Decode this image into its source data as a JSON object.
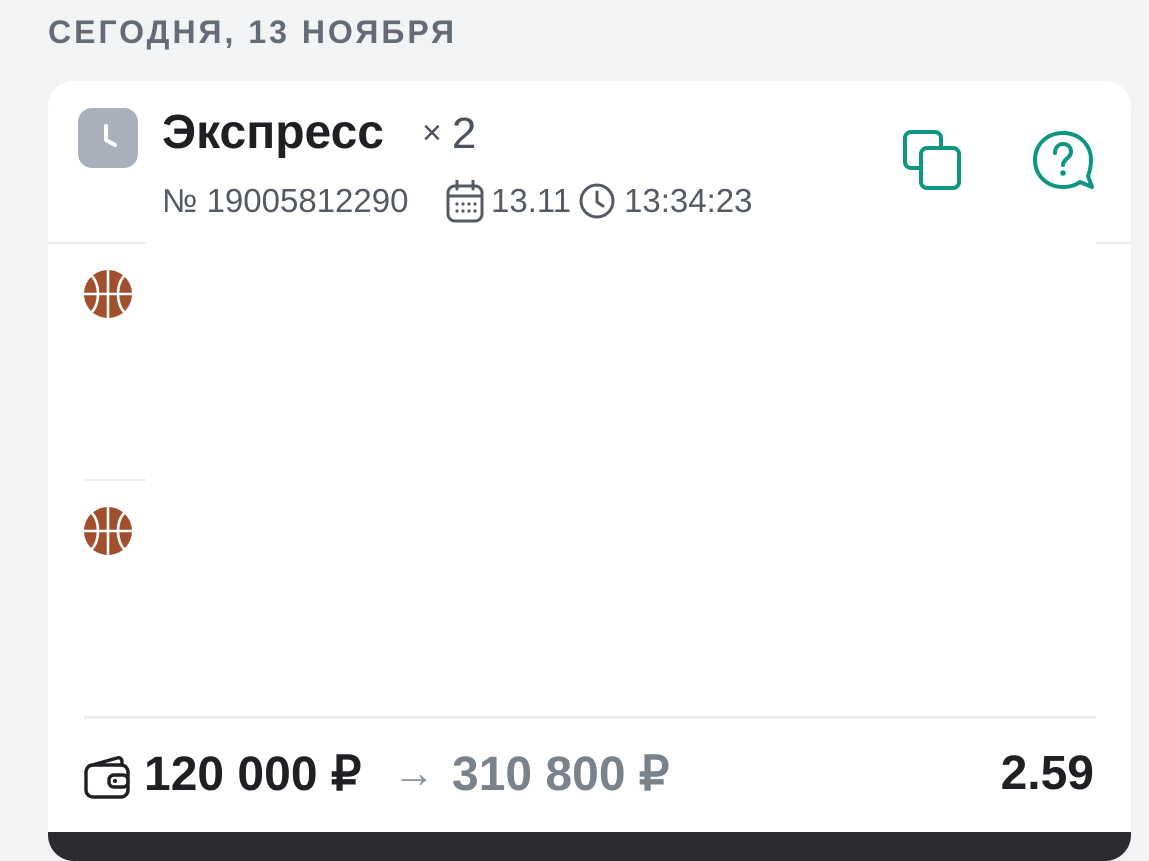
{
  "section": {
    "date_header": "СЕГОДНЯ, 13 НОЯБРЯ"
  },
  "bet": {
    "status_icon": "clock-icon",
    "type_label": "Экспресс",
    "multiplier_symbol": "×",
    "event_count": "2",
    "number": "№ 19005812290",
    "date": "13.11",
    "time": "13:34:23",
    "actions": {
      "copy_icon": "copy-icon",
      "help_icon": "help-chat-icon"
    },
    "events": [
      {
        "sport_icon": "basketball-icon"
      },
      {
        "sport_icon": "basketball-icon"
      }
    ],
    "stake": "120 000 ₽",
    "arrow": "→",
    "payout": "310 800 ₽",
    "coefficient": "2.59"
  },
  "colors": {
    "accent": "#0e9683",
    "basketball": "#a24f2d",
    "status_icon_bg": "#a9afbb",
    "page_bg": "#f2f3f5",
    "text_dark": "#1f2023",
    "text_muted": "#7a828c"
  }
}
